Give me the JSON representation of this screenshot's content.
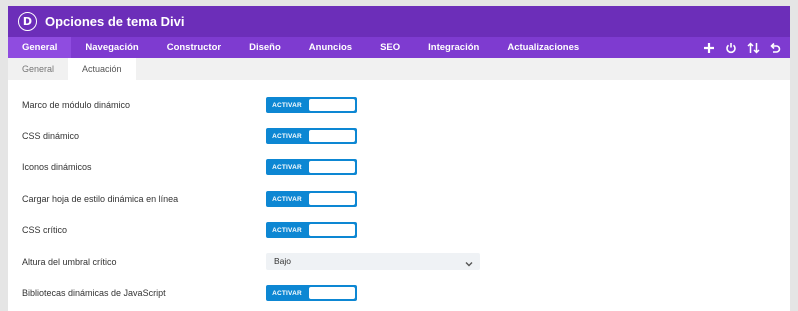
{
  "header": {
    "logo_letter": "D",
    "title": "Opciones de tema Divi"
  },
  "main_tabs": [
    "General",
    "Navegación",
    "Constructor",
    "Diseño",
    "Anuncios",
    "SEO",
    "Integración",
    "Actualizaciones"
  ],
  "header_icons": [
    "plus-icon",
    "power-icon",
    "sort-arrows-icon",
    "undo-icon"
  ],
  "sub_tabs": [
    "General",
    "Actuación"
  ],
  "settings": [
    {
      "label": "Marco de módulo dinámico",
      "toggle": "ACTIVAR"
    },
    {
      "label": "CSS dinámico",
      "toggle": "ACTIVAR"
    },
    {
      "label": "Iconos dinámicos",
      "toggle": "ACTIVAR"
    },
    {
      "label": "Cargar hoja de estilo dinámica en línea",
      "toggle": "ACTIVAR"
    },
    {
      "label": "CSS crítico",
      "toggle": "ACTIVAR"
    },
    {
      "label": "Altura del umbral crítico",
      "select": "Bajo"
    },
    {
      "label": "Bibliotecas dinámicas de JavaScript",
      "toggle": "ACTIVAR"
    }
  ],
  "colors": {
    "title_bar": "#6c2eb9",
    "nav_bar": "#7e3bd0",
    "toggle_on": "#0d87d3"
  }
}
